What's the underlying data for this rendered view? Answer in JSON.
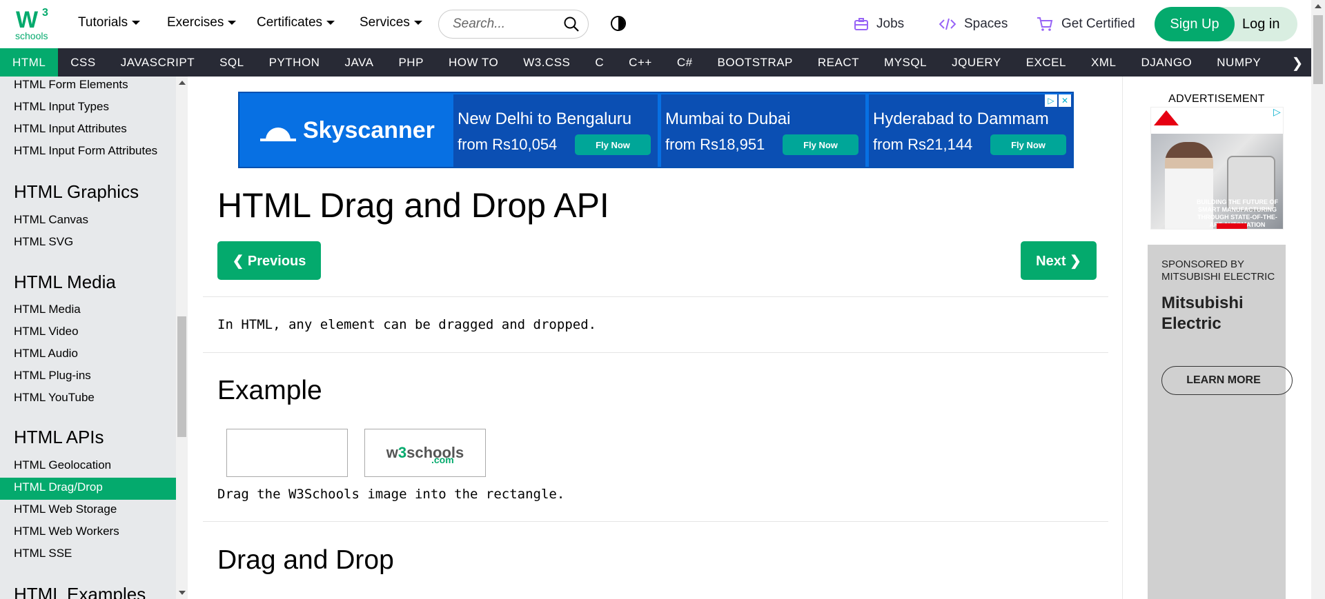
{
  "logo": {
    "main": "W",
    "sup": "3",
    "sub": "schools"
  },
  "topnav": {
    "menus": [
      "Tutorials",
      "Exercises",
      "Certificates",
      "Services"
    ],
    "search_placeholder": "Search...",
    "jobs": "Jobs",
    "spaces": "Spaces",
    "get_certified": "Get Certified",
    "signup": "Sign Up",
    "login": "Log in"
  },
  "subjects": [
    "HTML",
    "CSS",
    "JAVASCRIPT",
    "SQL",
    "PYTHON",
    "JAVA",
    "PHP",
    "HOW TO",
    "W3.CSS",
    "C",
    "C++",
    "C#",
    "BOOTSTRAP",
    "REACT",
    "MYSQL",
    "JQUERY",
    "EXCEL",
    "XML",
    "DJANGO",
    "NUMPY"
  ],
  "sidebar": {
    "links_top": [
      "HTML Form Elements",
      "HTML Input Types",
      "HTML Input Attributes",
      "HTML Input Form Attributes"
    ],
    "graphics_heading": "HTML Graphics",
    "graphics": [
      "HTML Canvas",
      "HTML SVG"
    ],
    "media_heading": "HTML Media",
    "media": [
      "HTML Media",
      "HTML Video",
      "HTML Audio",
      "HTML Plug-ins",
      "HTML YouTube"
    ],
    "apis_heading": "HTML APIs",
    "apis": [
      "HTML Geolocation",
      "HTML Drag/Drop",
      "HTML Web Storage",
      "HTML Web Workers",
      "HTML SSE"
    ],
    "examples_heading": "HTML Examples"
  },
  "ad_banner": {
    "brand": "Skyscanner",
    "offers": [
      {
        "route": "New Delhi to Bengaluru",
        "price": "from Rs10,054",
        "cta": "Fly Now"
      },
      {
        "route": "Mumbai to Dubai",
        "price": "from Rs18,951",
        "cta": "Fly Now"
      },
      {
        "route": "Hyderabad to Dammam",
        "price": "from Rs21,144",
        "cta": "Fly Now"
      }
    ]
  },
  "content": {
    "title": "HTML Drag and Drop API",
    "previous": "❮ Previous",
    "next": "Next ❯",
    "intro": "In HTML, any element can be dragged and dropped.",
    "example_heading": "Example",
    "image_text": {
      "w": "w",
      "three": "3",
      "schools": "schools",
      "com": ".com"
    },
    "caption": "Drag the W3Schools image into the rectangle.",
    "section_heading": "Drag and Drop"
  },
  "right": {
    "ad_label": "ADVERTISEMENT",
    "ad_image_text": "BUILDING THE FUTURE OF SMART MANUFACTURING THROUGH STATE-OF-THE-ART AUTOMATION SOLUTIONS",
    "sponsor_label": "SPONSORED BY MITSUBISHI ELECTRIC",
    "sponsor_brand": "Mitsubishi Electric",
    "learn_more": "LEARN MORE"
  },
  "colors": {
    "brand_green": "#04AA6D",
    "dark_nav": "#282A35",
    "sidebar_bg": "#E7E9EB",
    "skyscanner_blue": "#0770e3"
  }
}
